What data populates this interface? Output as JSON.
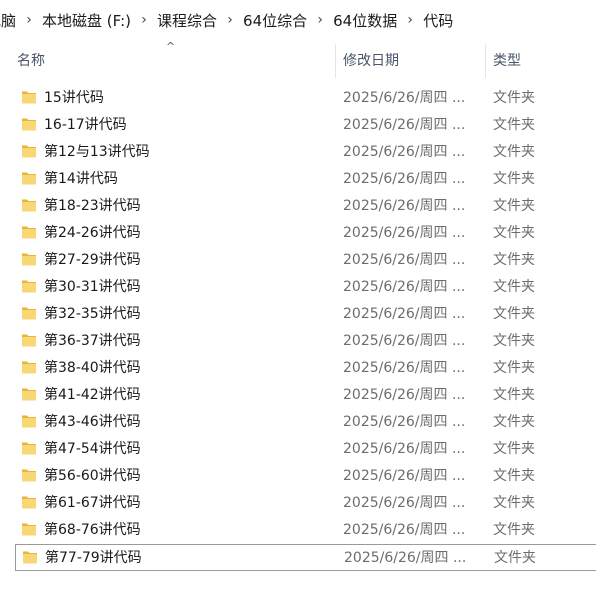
{
  "breadcrumb": {
    "items": [
      "电脑",
      "本地磁盘 (F:)",
      "课程综合",
      "64位综合",
      "64位数据",
      "代码"
    ],
    "separator": "›"
  },
  "columns": {
    "name": "名称",
    "date": "修改日期",
    "type": "类型",
    "sort_indicator": "^"
  },
  "colors": {
    "folder_body": "#f8d775",
    "folder_tab": "#e8b73a",
    "header_text": "#4a5568",
    "secondary_text": "#6d6d6d"
  },
  "files": [
    {
      "name": "15讲代码",
      "date": "2025/6/26/周四 ...",
      "type": "文件夹",
      "icon": "folder-icon"
    },
    {
      "name": "16-17讲代码",
      "date": "2025/6/26/周四 ...",
      "type": "文件夹",
      "icon": "folder-icon"
    },
    {
      "name": "第12与13讲代码",
      "date": "2025/6/26/周四 ...",
      "type": "文件夹",
      "icon": "folder-icon"
    },
    {
      "name": "第14讲代码",
      "date": "2025/6/26/周四 ...",
      "type": "文件夹",
      "icon": "folder-icon"
    },
    {
      "name": "第18-23讲代码",
      "date": "2025/6/26/周四 ...",
      "type": "文件夹",
      "icon": "folder-icon"
    },
    {
      "name": "第24-26讲代码",
      "date": "2025/6/26/周四 ...",
      "type": "文件夹",
      "icon": "folder-icon"
    },
    {
      "name": "第27-29讲代码",
      "date": "2025/6/26/周四 ...",
      "type": "文件夹",
      "icon": "folder-icon"
    },
    {
      "name": "第30-31讲代码",
      "date": "2025/6/26/周四 ...",
      "type": "文件夹",
      "icon": "folder-icon"
    },
    {
      "name": "第32-35讲代码",
      "date": "2025/6/26/周四 ...",
      "type": "文件夹",
      "icon": "folder-icon"
    },
    {
      "name": "第36-37讲代码",
      "date": "2025/6/26/周四 ...",
      "type": "文件夹",
      "icon": "folder-icon"
    },
    {
      "name": "第38-40讲代码",
      "date": "2025/6/26/周四 ...",
      "type": "文件夹",
      "icon": "folder-icon"
    },
    {
      "name": "第41-42讲代码",
      "date": "2025/6/26/周四 ...",
      "type": "文件夹",
      "icon": "folder-icon"
    },
    {
      "name": "第43-46讲代码",
      "date": "2025/6/26/周四 ...",
      "type": "文件夹",
      "icon": "folder-icon"
    },
    {
      "name": "第47-54讲代码",
      "date": "2025/6/26/周四 ...",
      "type": "文件夹",
      "icon": "folder-icon"
    },
    {
      "name": "第56-60讲代码",
      "date": "2025/6/26/周四 ...",
      "type": "文件夹",
      "icon": "folder-icon"
    },
    {
      "name": "第61-67讲代码",
      "date": "2025/6/26/周四 ...",
      "type": "文件夹",
      "icon": "folder-icon"
    },
    {
      "name": "第68-76讲代码",
      "date": "2025/6/26/周四 ...",
      "type": "文件夹",
      "icon": "folder-icon"
    },
    {
      "name": "第77-79讲代码",
      "date": "2025/6/26/周四 ...",
      "type": "文件夹",
      "icon": "folder-icon",
      "focused": true
    }
  ]
}
